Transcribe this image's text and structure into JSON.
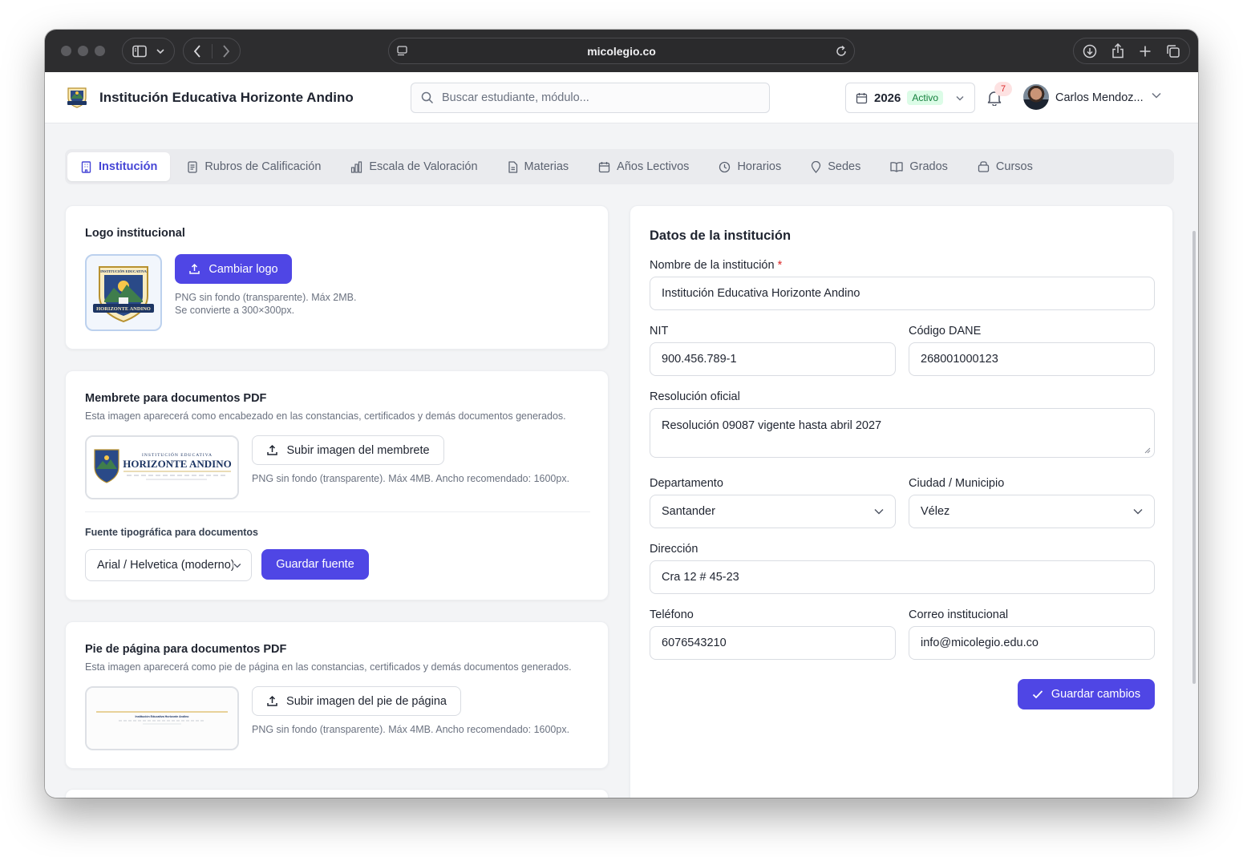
{
  "browser": {
    "url": "micolegio.co"
  },
  "header": {
    "institution_name": "Institución Educativa Horizonte Andino",
    "search_placeholder": "Buscar estudiante, módulo...",
    "year": "2026",
    "year_status": "Activo",
    "notifications_count": "7",
    "user_name": "Carlos Mendoz..."
  },
  "tabs": [
    {
      "label": "Institución",
      "icon": "building-icon",
      "active": true
    },
    {
      "label": "Rubros de Calificación",
      "icon": "document-icon"
    },
    {
      "label": "Escala de Valoración",
      "icon": "bar-chart-icon"
    },
    {
      "label": "Materias",
      "icon": "file-icon"
    },
    {
      "label": "Años Lectivos",
      "icon": "calendar-icon"
    },
    {
      "label": "Horarios",
      "icon": "clock-icon"
    },
    {
      "label": "Sedes",
      "icon": "pin-icon"
    },
    {
      "label": "Grados",
      "icon": "book-icon"
    },
    {
      "label": "Cursos",
      "icon": "briefcase-icon"
    }
  ],
  "logo_card": {
    "title": "Logo institucional",
    "button": "Cambiar logo",
    "hint_line1": "PNG sin fondo (transparente). Máx 2MB.",
    "hint_line2": "Se convierte a 300×300px.",
    "logo_text_top": "INSTITUCIÓN EDUCATIVA",
    "logo_text_banner": "HORIZONTE ANDINO"
  },
  "letterhead_card": {
    "title": "Membrete para documentos PDF",
    "subtitle": "Esta imagen aparecerá como encabezado en las constancias, certificados y demás documentos generados.",
    "button": "Subir imagen del membrete",
    "hint": "PNG sin fondo (transparente). Máx 4MB. Ancho recomendado: 1600px.",
    "preview_small": "INSTITUCIÓN EDUCATIVA",
    "preview_big": "HORIZONTE ANDINO",
    "font_label": "Fuente tipográfica para documentos",
    "font_value": "Arial / Helvetica (moderno)",
    "font_button": "Guardar fuente"
  },
  "footer_card": {
    "title": "Pie de página para documentos PDF",
    "subtitle": "Esta imagen aparecerá como pie de página en las constancias, certificados y demás documentos generados.",
    "button": "Subir imagen del pie de página",
    "hint": "PNG sin fondo (transparente). Máx 4MB. Ancho recomendado: 1600px.",
    "preview_text": "Institución Educativa Horizonte Andino"
  },
  "form": {
    "title": "Datos de la institución",
    "name_label": "Nombre de la institución",
    "name_required": "*",
    "name_value": "Institución Educativa Horizonte Andino",
    "nit_label": "NIT",
    "nit_value": "900.456.789-1",
    "dane_label": "Código DANE",
    "dane_value": "268001000123",
    "resolution_label": "Resolución oficial",
    "resolution_value": "Resolución 09087 vigente hasta abril 2027",
    "department_label": "Departamento",
    "department_value": "Santander",
    "city_label": "Ciudad / Municipio",
    "city_value": "Vélez",
    "address_label": "Dirección",
    "address_value": "Cra 12 # 45-23",
    "phone_label": "Teléfono",
    "phone_value": "6076543210",
    "email_label": "Correo institucional",
    "email_value": "info@micolegio.edu.co",
    "save_button": "Guardar cambios"
  },
  "colors": {
    "accent": "#4f46e5",
    "active_badge_bg": "#dcfce7",
    "active_badge_text": "#15803d",
    "notification": "#dc2626"
  }
}
